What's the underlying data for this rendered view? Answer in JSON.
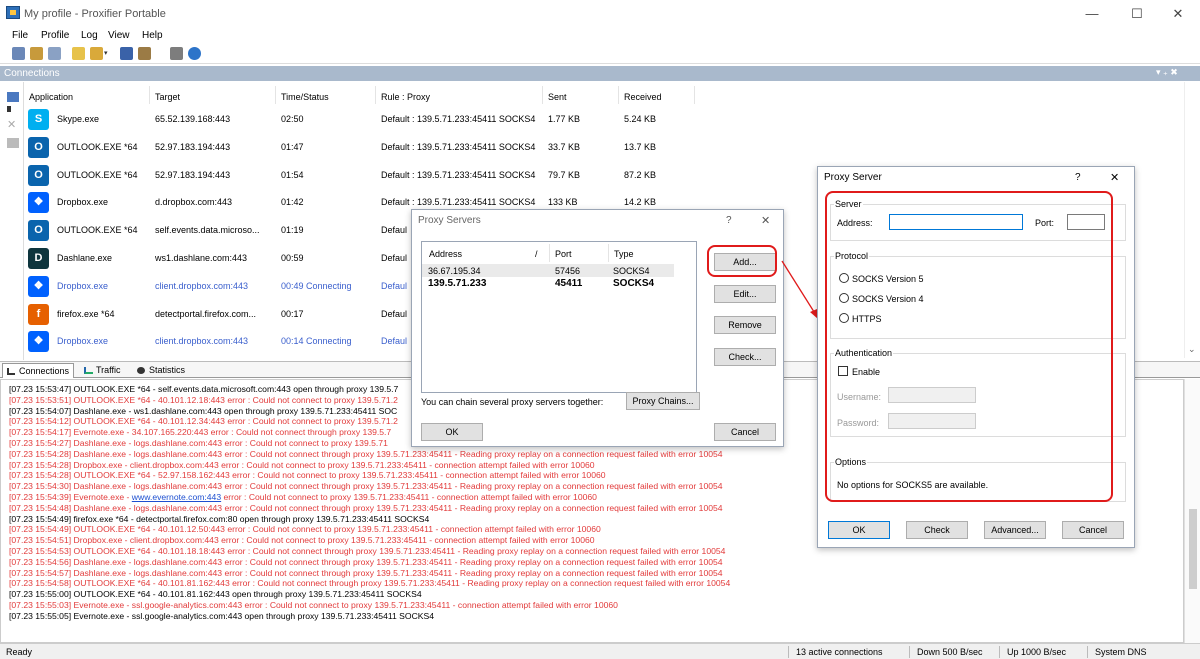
{
  "window": {
    "title": "My profile - Proxifier Portable"
  },
  "menu": [
    "File",
    "Profile",
    "Log",
    "View",
    "Help"
  ],
  "connections_panel": {
    "title": "Connections",
    "controls": "▾ ₊ ✖"
  },
  "columns": [
    "Application",
    "Target",
    "Time/Status",
    "Rule : Proxy",
    "Sent",
    "Received"
  ],
  "rows": [
    {
      "app": "Skype.exe",
      "target": "65.52.139.168:443",
      "time": "02:50",
      "rule": "Default : 139.5.71.233:45411 SOCKS4",
      "sent": "1.77 KB",
      "recv": "5.24 KB",
      "icon": "skype-icon",
      "color": "#00aff0",
      "glyph": "S",
      "status": "active"
    },
    {
      "app": "OUTLOOK.EXE *64",
      "target": "52.97.183.194:443",
      "time": "01:47",
      "rule": "Default : 139.5.71.233:45411 SOCKS4",
      "sent": "33.7 KB",
      "recv": "13.7 KB",
      "icon": "outlook-icon",
      "color": "#0a64ad",
      "glyph": "O",
      "status": "active"
    },
    {
      "app": "OUTLOOK.EXE *64",
      "target": "52.97.183.194:443",
      "time": "01:54",
      "rule": "Default : 139.5.71.233:45411 SOCKS4",
      "sent": "79.7 KB",
      "recv": "87.2 KB",
      "icon": "outlook-icon",
      "color": "#0a64ad",
      "glyph": "O",
      "status": "active"
    },
    {
      "app": "Dropbox.exe",
      "target": "d.dropbox.com:443",
      "time": "01:42",
      "rule": "Default : 139.5.71.233:45411 SOCKS4",
      "sent": "133 KB",
      "recv": "14.2 KB",
      "icon": "dropbox-icon",
      "color": "#0061fe",
      "glyph": "❖",
      "status": "active"
    },
    {
      "app": "OUTLOOK.EXE *64",
      "target": "self.events.data.microso...",
      "time": "01:19",
      "rule": "Defaul",
      "sent": "",
      "recv": "",
      "icon": "outlook-icon",
      "color": "#0a64ad",
      "glyph": "O",
      "status": "active"
    },
    {
      "app": "Dashlane.exe",
      "target": "ws1.dashlane.com:443",
      "time": "00:59",
      "rule": "Defaul",
      "sent": "",
      "recv": "",
      "icon": "dashlane-icon",
      "color": "#0e353d",
      "glyph": "D",
      "status": "active"
    },
    {
      "app": "Dropbox.exe",
      "target": "client.dropbox.com:443",
      "time": "00:49 Connecting",
      "rule": "Defaul",
      "sent": "",
      "recv": "",
      "icon": "dropbox-icon",
      "color": "#0061fe",
      "glyph": "❖",
      "status": "connecting"
    },
    {
      "app": "firefox.exe *64",
      "target": "detectportal.firefox.com...",
      "time": "00:17",
      "rule": "Defaul",
      "sent": "",
      "recv": "",
      "icon": "firefox-icon",
      "color": "#e66000",
      "glyph": "f",
      "status": "active"
    },
    {
      "app": "Dropbox.exe",
      "target": "client.dropbox.com:443",
      "time": "00:14 Connecting",
      "rule": "Defaul",
      "sent": "",
      "recv": "",
      "icon": "dropbox-icon",
      "color": "#0061fe",
      "glyph": "❖",
      "status": "connecting"
    }
  ],
  "tabs": [
    "Connections",
    "Traffic",
    "Statistics"
  ],
  "log": [
    {
      "t": "[07.23 15:53:47] OUTLOOK.EXE *64 - self.events.data.microsoft.com:443 open through proxy 139.5.7",
      "err": false
    },
    {
      "t": "[07.23 15:53:51] OUTLOOK.EXE *64 - 40.101.12.18:443 error : Could not connect to proxy 139.5.71.2",
      "err": true
    },
    {
      "t": "[07.23 15:54:07] Dashlane.exe - ws1.dashlane.com:443 open through proxy 139.5.71.233:45411 SOC",
      "err": false
    },
    {
      "t": "[07.23 15:54:12] OUTLOOK.EXE *64 - 40.101.12.34:443 error : Could not connect to proxy 139.5.71.2",
      "err": true
    },
    {
      "t": "[07.23 15:54:17] Evernote.exe - 34.107.165.220:443 error : Could not connect through proxy 139.5.7",
      "err": true
    },
    {
      "t": "[07.23 15:54:27] Dashlane.exe - logs.dashlane.com:443 error : Could not connect to proxy 139.5.71",
      "err": true
    },
    {
      "t": "[07.23 15:54:28] Dashlane.exe - logs.dashlane.com:443 error : Could not connect through proxy 139.5.71.233:45411 - Reading proxy replay on a connection request failed with error 10054",
      "err": true
    },
    {
      "t": "[07.23 15:54:28] Dropbox.exe - client.dropbox.com:443 error : Could not connect to proxy 139.5.71.233:45411 - connection attempt failed with error 10060",
      "err": true
    },
    {
      "t": "[07.23 15:54:28] OUTLOOK.EXE *64 - 52.97.158.162:443 error : Could not connect to proxy 139.5.71.233:45411 - connection attempt failed with error 10060",
      "err": true
    },
    {
      "t": "[07.23 15:54:30] Dashlane.exe - logs.dashlane.com:443 error : Could not connect through proxy 139.5.71.233:45411 - Reading proxy replay on a connection request failed with error 10054",
      "err": true
    },
    {
      "t": "[07.23 15:54:39] Evernote.exe - ",
      "link": "www.evernote.com:443",
      "t2": " error : Could not connect to proxy 139.5.71.233:45411 - connection attempt failed with error 10060",
      "err": true
    },
    {
      "t": "[07.23 15:54:48] Dashlane.exe - logs.dashlane.com:443 error : Could not connect through proxy 139.5.71.233:45411 - Reading proxy replay on a connection request failed with error 10054",
      "err": true
    },
    {
      "t": "[07.23 15:54:49] firefox.exe *64 - detectportal.firefox.com:80 open through proxy 139.5.71.233:45411 SOCKS4",
      "err": false
    },
    {
      "t": "[07.23 15:54:49] OUTLOOK.EXE *64 - 40.101.12.50:443 error : Could not connect to proxy 139.5.71.233:45411 - connection attempt failed with error 10060",
      "err": true
    },
    {
      "t": "[07.23 15:54:51] Dropbox.exe - client.dropbox.com:443 error : Could not connect to proxy 139.5.71.233:45411 - connection attempt failed with error 10060",
      "err": true
    },
    {
      "t": "[07.23 15:54:53] OUTLOOK.EXE *64 - 40.101.18.18:443 error : Could not connect through proxy 139.5.71.233:45411 - Reading proxy replay on a connection request failed with error 10054",
      "err": true
    },
    {
      "t": "[07.23 15:54:56] Dashlane.exe - logs.dashlane.com:443 error : Could not connect through proxy 139.5.71.233:45411 - Reading proxy replay on a connection request failed with error 10054",
      "err": true
    },
    {
      "t": "[07.23 15:54:57] Dashlane.exe - logs.dashlane.com:443 error : Could not connect through proxy 139.5.71.233:45411 - Reading proxy replay on a connection request failed with error 10054",
      "err": true
    },
    {
      "t": "[07.23 15:54:58] OUTLOOK.EXE *64 - 40.101.81.162:443 error : Could not connect through proxy 139.5.71.233:45411 - Reading proxy replay on a connection request failed with error 10054",
      "err": true
    },
    {
      "t": "[07.23 15:55:00] OUTLOOK.EXE *64 - 40.101.81.162:443 open through proxy 139.5.71.233:45411 SOCKS4",
      "err": false
    },
    {
      "t": "[07.23 15:55:03] Evernote.exe - ssl.google-analytics.com:443 error : Could not connect to proxy 139.5.71.233:45411 - connection attempt failed with error 10060",
      "err": true
    },
    {
      "t": "[07.23 15:55:05] Evernote.exe - ssl.google-analytics.com:443 open through proxy 139.5.71.233:45411 SOCKS4",
      "err": false
    }
  ],
  "status": {
    "ready": "Ready",
    "active": "13 active connections",
    "down": "Down 500 B/sec",
    "up": "Up 1000 B/sec",
    "dns": "System DNS"
  },
  "proxy_servers_dialog": {
    "title": "Proxy Servers",
    "help": "?",
    "close": "✕",
    "cols": [
      "Address",
      "/",
      "Port",
      "Type"
    ],
    "rows": [
      {
        "addr": "36.67.195.34",
        "port": "57456",
        "type": "SOCKS4",
        "bold": false
      },
      {
        "addr": "139.5.71.233",
        "port": "45411",
        "type": "SOCKS4",
        "bold": true
      }
    ],
    "buttons": {
      "add": "Add...",
      "edit": "Edit...",
      "remove": "Remove",
      "check": "Check...",
      "chains": "Proxy Chains...",
      "ok": "OK",
      "cancel": "Cancel"
    },
    "chain_text": "You can chain several proxy servers together:"
  },
  "proxy_server_dialog": {
    "title": "Proxy Server",
    "help": "?",
    "close": "✕",
    "server_label": "Server",
    "address_label": "Address:",
    "address_value": "",
    "port_label": "Port:",
    "port_value": "",
    "protocol_label": "Protocol",
    "protocols": [
      "SOCKS Version 5",
      "SOCKS Version 4",
      "HTTPS"
    ],
    "auth_label": "Authentication",
    "enable_label": "Enable",
    "username_label": "Username:",
    "password_label": "Password:",
    "options_label": "Options",
    "options_text": "No options for SOCKS5 are available.",
    "buttons": {
      "ok": "OK",
      "check": "Check",
      "advanced": "Advanced...",
      "cancel": "Cancel"
    }
  }
}
